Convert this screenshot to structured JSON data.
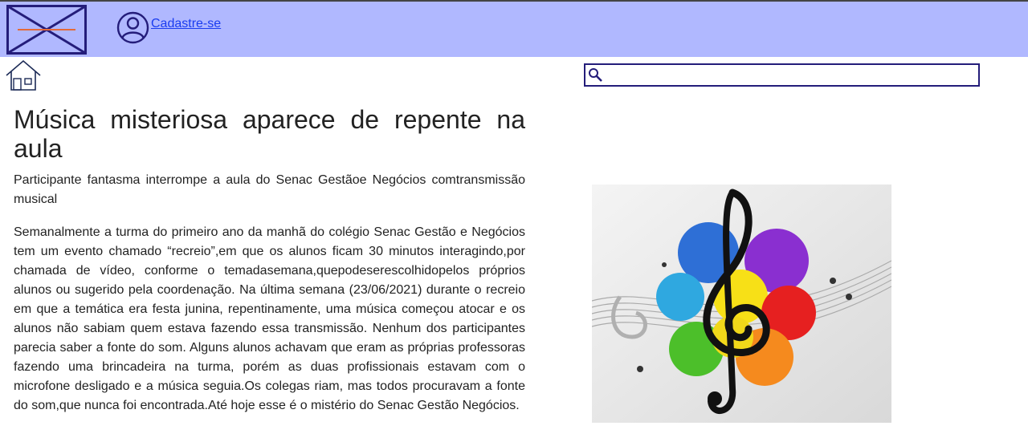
{
  "header": {
    "background": "#b0b8ff",
    "logo_icon": "logo-x-icon",
    "user_icon": "user-circle-icon",
    "signup_label": "Cadastre-se"
  },
  "nav": {
    "home_icon": "home-icon"
  },
  "search": {
    "value": "",
    "placeholder": "",
    "icon": "search-icon",
    "border_color": "#241d7a"
  },
  "article": {
    "title": "Música misteriosa aparece de repente na aula",
    "subtitle": "Participante fantasma interrompe a aula do Senac Gestãoe Negócios comtransmissão musical",
    "body": "Semanalmente a turma do primeiro ano da manhã do colégio Senac Gestão e Negócios tem um evento chamado “recreio”,em que os alunos ficam 30 minutos interagindo,por chamada de vídeo, conforme o temadasemana,quepodeserescolhidopelos próprios alunos ou sugerido pela coordenação. Na última semana (23/06/2021) durante o recreio em que a temática era festa junina, repentinamente, uma música começou atocar e os alunos não sabiam quem estava fazendo essa transmissão. Nenhum dos participantes parecia saber a fonte do som. Alguns alunos achavam que eram as próprias professoras fazendo uma brincadeira na turma, porém as duas profissionais estavam com o microfone desligado e a música seguia.Os colegas riam, mas todos procuravam a fonte do som,que nunca foi encontrada.Até hoje esse é o mistério do Senac Gestão Negócios."
  },
  "image": {
    "subject": "treble-clef-color-splash-illustration"
  }
}
